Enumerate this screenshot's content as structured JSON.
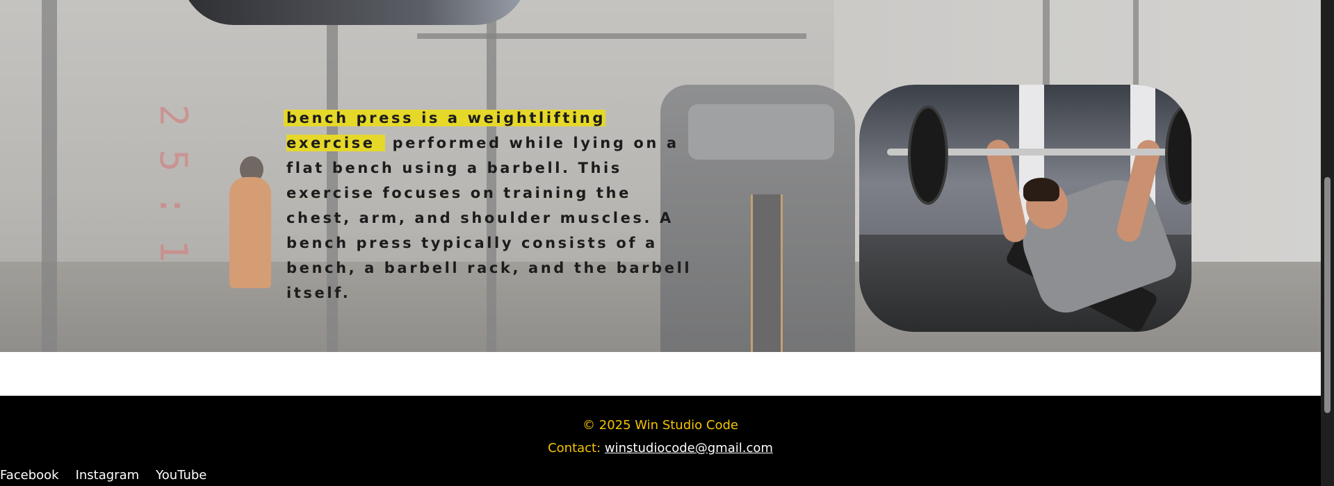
{
  "article": {
    "highlight": "bench press is a weightlifting exercise",
    "body": "performed while lying on a flat bench using a barbell. This exercise focuses on training the chest, arm, and shoulder muscles. A bench press typically consists of a bench, a barbell rack, and the barbell itself.",
    "background_digits": "2 5 : 1"
  },
  "footer": {
    "copyright": "© 2025 Win Studio Code",
    "contact_label": "Contact:",
    "contact_email": "winstudiocode@gmail.com",
    "social_links": [
      "Facebook",
      "Instagram",
      "YouTube"
    ]
  },
  "colors": {
    "highlight": "#e6d829",
    "footer_background": "#000000",
    "footer_text": "#f5c400",
    "link": "#ffffff"
  },
  "icons": [
    "scrollbar-thumb"
  ]
}
